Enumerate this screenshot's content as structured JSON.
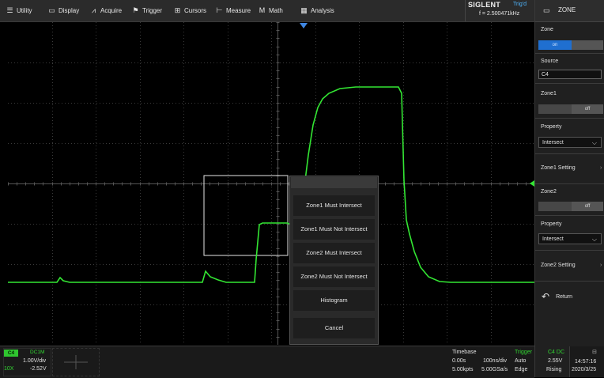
{
  "menu": {
    "items": [
      {
        "id": "utility",
        "label": "Utility",
        "icon": "utility-icon"
      },
      {
        "id": "display",
        "label": "Display",
        "icon": "display-icon"
      },
      {
        "id": "acquire",
        "label": "Acquire",
        "icon": "acquire-icon"
      },
      {
        "id": "trigger",
        "label": "Trigger",
        "icon": "flag-icon"
      },
      {
        "id": "cursors",
        "label": "Cursors",
        "icon": "cursors-icon"
      },
      {
        "id": "measure",
        "label": "Measure",
        "icon": "measure-icon"
      },
      {
        "id": "math",
        "label": "Math",
        "icon": "math-icon"
      },
      {
        "id": "analysis",
        "label": "Analysis",
        "icon": "analysis-icon"
      }
    ],
    "brand": "SIGLENT",
    "trigger_status": "Trig'd",
    "frequency": "f = 2.500471kHz"
  },
  "sidebar": {
    "title": "ZONE",
    "zone_label": "Zone",
    "zone_state": "on",
    "source_label": "Source",
    "source_value": "C4",
    "zone1_label": "Zone1",
    "zone1_state": "off",
    "property1_label": "Property",
    "property1_value": "Intersect",
    "zone1_setting": "Zone1 Setting",
    "zone2_label": "Zone2",
    "zone2_state": "off",
    "property2_label": "Property",
    "property2_value": "Intersect",
    "zone2_setting": "Zone2 Setting",
    "return_label": "Return"
  },
  "popup": {
    "items": [
      "Zone1 Must Intersect",
      "Zone1 Must Not Intersect",
      "Zone2 Must Intersect",
      "Zone2 Must Not Intersect",
      "Histogram",
      "Cancel"
    ]
  },
  "channel": {
    "name": "C4",
    "coupling": "DC1M",
    "volts_div": "1.00V/div",
    "probe": "10X",
    "offset": "-2.52V"
  },
  "timebase": {
    "title": "Timebase",
    "delay": "0.00s",
    "time_div": "100ns/div",
    "points": "5.00kpts",
    "sample_rate": "5.00GSa/s"
  },
  "trigger": {
    "title": "Trigger",
    "source": "C4 DC",
    "mode": "Auto",
    "level": "2.55V",
    "type": "Edge",
    "slope": "Rising"
  },
  "clock": {
    "time": "14:57:16",
    "date": "2020/3/25"
  },
  "colors": {
    "trace": "#33e633",
    "accent": "#1f6fd0",
    "trigger_status": "#4fb6ff"
  }
}
